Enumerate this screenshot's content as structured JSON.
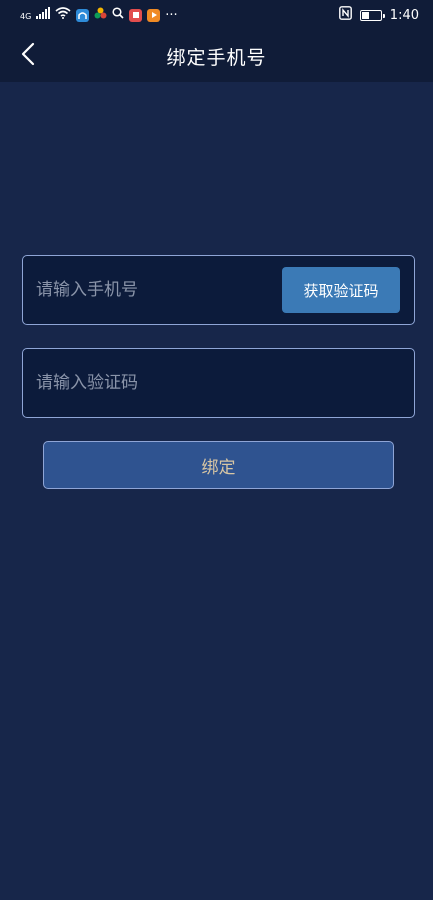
{
  "status_bar": {
    "network": "4G",
    "time": "1:40",
    "more": "···",
    "nfc": "N"
  },
  "header": {
    "title": "绑定手机号"
  },
  "form": {
    "phone_placeholder": "请输入手机号",
    "get_code_label": "获取验证码",
    "code_placeholder": "请输入验证码",
    "bind_label": "绑定"
  },
  "colors": {
    "background": "#17264a",
    "header_background": "#101c38",
    "field_background": "#0c1b3b",
    "field_border": "#8fa5d6",
    "code_button": "#3b7ab6",
    "bind_button": "#2f5390",
    "bind_text": "#d8c6a4"
  },
  "icons": {
    "back": "chevron-left-icon",
    "signal": "signal-icon",
    "wifi": "wifi-icon",
    "search": "search-icon",
    "nfc": "nfc-icon",
    "battery": "battery-icon"
  },
  "battery_level": 0.4
}
